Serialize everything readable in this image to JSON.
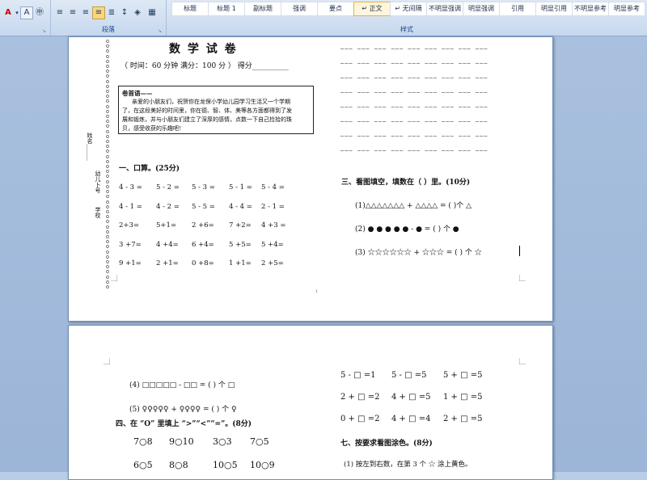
{
  "ribbon": {
    "paragraph_group_label": "段落",
    "styles_group_label": "样式",
    "styles": [
      "标题",
      "标题 1",
      "副标题",
      "强调",
      "要点",
      "↵ 正文",
      "↵ 无间隔",
      "不明显强调",
      "明显强调",
      "引用",
      "明显引用",
      "不明显参考",
      "明显参考"
    ],
    "active_style_index": 5
  },
  "page1": {
    "title": "数 学 试 卷",
    "meta": "（ 时间：60 分钟   满分：100 分 ）    得分__________",
    "intro_heading": "卷首语——",
    "intro_lines": [
      "亲爱的小朋友们，祝贺你在龙保小学幼儿园学习生活又一个学期",
      "了，在这段美好的时间里，你在德、智、体、美等各方面都得到了发",
      "展和锻炼，并与小朋友们建立了深厚的感情，点数一下自己捡拾的珠",
      "贝，感受收获的乐趣吧！"
    ],
    "side_labels": [
      "姓名______",
      "幼儿卜号",
      "学校"
    ],
    "section1_heading": "一、口算。(25分)",
    "oral_rows": [
      [
        "4 - 3 =",
        "5 - 2 =",
        "5 - 3 =",
        "5 - 1 =",
        "5 - 4 ="
      ],
      [
        "4 - 1 =",
        "4 - 2 =",
        "5 - 5 =",
        "4 - 4 =",
        "2 - 1 ="
      ],
      [
        "2+3=",
        "5+1=",
        "2 +6=",
        "7 +2=",
        "4 +3 ="
      ],
      [
        "3 +7=",
        "4 +4=",
        "6 +4=",
        "5 +5=",
        "5 +4="
      ],
      [
        "9 +1=",
        "2 +1=",
        "0 +8=",
        "1 +1=",
        "2 +5="
      ]
    ],
    "dash_rows": 8,
    "section3_heading": "三、看图填空，填数在（    ）里。(10分)",
    "pic_rows": [
      "(1)△△△△△△△ + △△△△  = (     )个 △",
      "(2) ● ● ● ● ● - ● = (      ) 个 ●",
      "(3) ☆☆☆☆☆☆ + ☆☆☆  = (     ) 个 ☆"
    ],
    "page_no": "1"
  },
  "page2": {
    "q4": "(4) □□□□□ - □□ = (     ) 个 □",
    "q5": "(5) ♀♀♀♀♀ + ♀♀♀♀ = (     ) 个 ♀",
    "section4_heading": "四、在 “O” 里填上 “>”“<”“=”。(8分)",
    "compare_rows": [
      [
        "7○8",
        "9○10",
        "3○3",
        "7○5"
      ],
      [
        "6○5",
        "8○8",
        "10○5",
        "10○9"
      ]
    ],
    "box_rows": [
      [
        "5 - □ =1",
        "5 - □ =5",
        "5 + □ =5"
      ],
      [
        "2 + □ =2",
        "4 + □ =5",
        "1 + □ =5"
      ],
      [
        "0 + □ =2",
        "4 + □ =4",
        "2 + □ =5"
      ]
    ],
    "section7_heading": "七、按要求看图涂色。(8分)",
    "section7_line": "(1) 按左到右数，在第 3 个 ☆ 涂上黄色。"
  },
  "colors": {
    "ribbon_active": "#f8d680",
    "canvas": "#a9c0de",
    "ribbon_text": "#15428b"
  }
}
